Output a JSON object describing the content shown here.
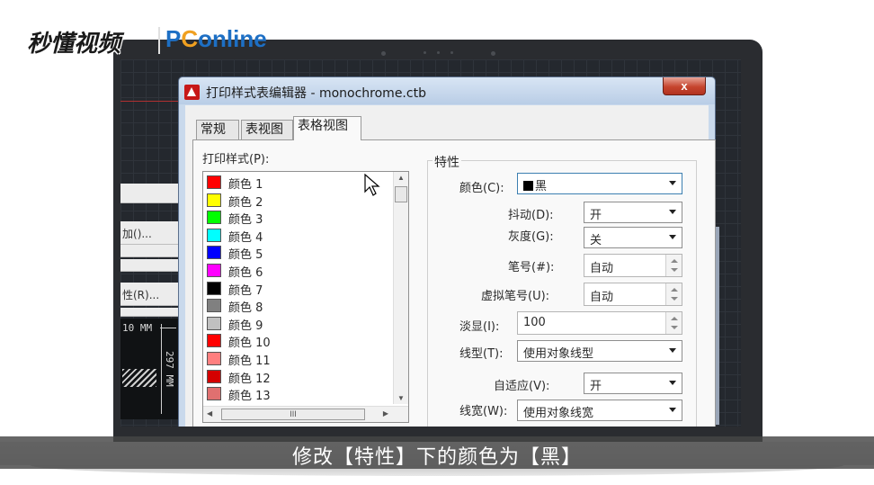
{
  "watermark": {
    "brand": "秒懂视频",
    "partner_prefix": "P",
    "partner_mid": "C",
    "partner_suffix": "online"
  },
  "left_panel": {
    "item_add": "加(",
    "item_add_suffix": ")...",
    "item_props": "性(R)...",
    "dimension_h": "10 MM",
    "dimension_v": "297 MM"
  },
  "dialog": {
    "title": "打印样式表编辑器 - monochrome.ctb",
    "close_label": "x",
    "tabs": [
      "常规",
      "表视图",
      "表格视图"
    ],
    "active_tab_index": 2,
    "list_label": "打印样式(P):",
    "styles": [
      {
        "label": "颜色 1",
        "color": "#ff0000"
      },
      {
        "label": "颜色 2",
        "color": "#ffff00"
      },
      {
        "label": "颜色 3",
        "color": "#00ff00"
      },
      {
        "label": "颜色 4",
        "color": "#00ffff"
      },
      {
        "label": "颜色 5",
        "color": "#0000ff"
      },
      {
        "label": "颜色 6",
        "color": "#ff00ff"
      },
      {
        "label": "颜色 7",
        "color": "#000000"
      },
      {
        "label": "颜色 8",
        "color": "#808080"
      },
      {
        "label": "颜色 9",
        "color": "#c0c0c0"
      },
      {
        "label": "颜色 10",
        "color": "#ff0000"
      },
      {
        "label": "颜色 11",
        "color": "#ff7f7f"
      },
      {
        "label": "颜色 12",
        "color": "#d40000"
      },
      {
        "label": "颜色 13",
        "color": "#e07070"
      }
    ],
    "hscroll_grip": "III",
    "properties": {
      "group_label": "特性",
      "color_label": "颜色(C):",
      "color_value": "黑",
      "dither_label": "抖动(D):",
      "dither_value": "开",
      "grayscale_label": "灰度(G):",
      "grayscale_value": "关",
      "pen_label": "笔号(#):",
      "pen_value": "自动",
      "virtual_pen_label": "虚拟笔号(U):",
      "virtual_pen_value": "自动",
      "screening_label": "淡显(I):",
      "screening_value": "100",
      "linetype_label": "线型(T):",
      "linetype_value": "使用对象线型",
      "adaptive_label": "自适应(V):",
      "adaptive_value": "开",
      "lineweight_label": "线宽(W):",
      "lineweight_value": "使用对象线宽"
    }
  },
  "subtitle": "修改【特性】下的颜色为【黑】"
}
